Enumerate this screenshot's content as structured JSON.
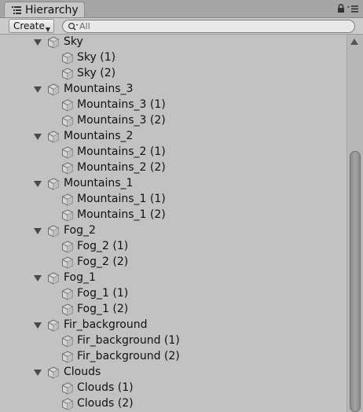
{
  "window": {
    "tab_title": "Hierarchy",
    "tab_icon": "list-icon",
    "controls": [
      "lock-icon",
      "menu-icon"
    ]
  },
  "toolbar": {
    "create_label": "Create",
    "search_placeholder": "All",
    "search_value": ""
  },
  "tree": {
    "groups": [
      {
        "name": "Sky",
        "expanded": true,
        "children": [
          "Sky (1)",
          "Sky (2)"
        ]
      },
      {
        "name": "Mountains_3",
        "expanded": true,
        "children": [
          "Mountains_3 (1)",
          "Mountains_3 (2)"
        ]
      },
      {
        "name": "Mountains_2",
        "expanded": true,
        "children": [
          "Mountains_2 (1)",
          "Mountains_2 (2)"
        ]
      },
      {
        "name": "Mountains_1",
        "expanded": true,
        "children": [
          "Mountains_1 (1)",
          "Mountains_1 (2)"
        ]
      },
      {
        "name": "Fog_2",
        "expanded": true,
        "children": [
          "Fog_2 (1)",
          "Fog_2 (2)"
        ]
      },
      {
        "name": "Fog_1",
        "expanded": true,
        "children": [
          "Fog_1 (1)",
          "Fog_1 (2)"
        ]
      },
      {
        "name": "Fir_background",
        "expanded": true,
        "children": [
          "Fir_background (1)",
          "Fir_background (2)"
        ]
      },
      {
        "name": "Clouds",
        "expanded": true,
        "children": [
          "Clouds (1)",
          "Clouds (2)"
        ]
      }
    ],
    "node_icon": "gameobject-cube-icon"
  },
  "colors": {
    "panel_bg": "#c2c2c2",
    "tab_bg": "#c8c8c8",
    "scroll_thumb": "#969696",
    "text": "#111111"
  }
}
